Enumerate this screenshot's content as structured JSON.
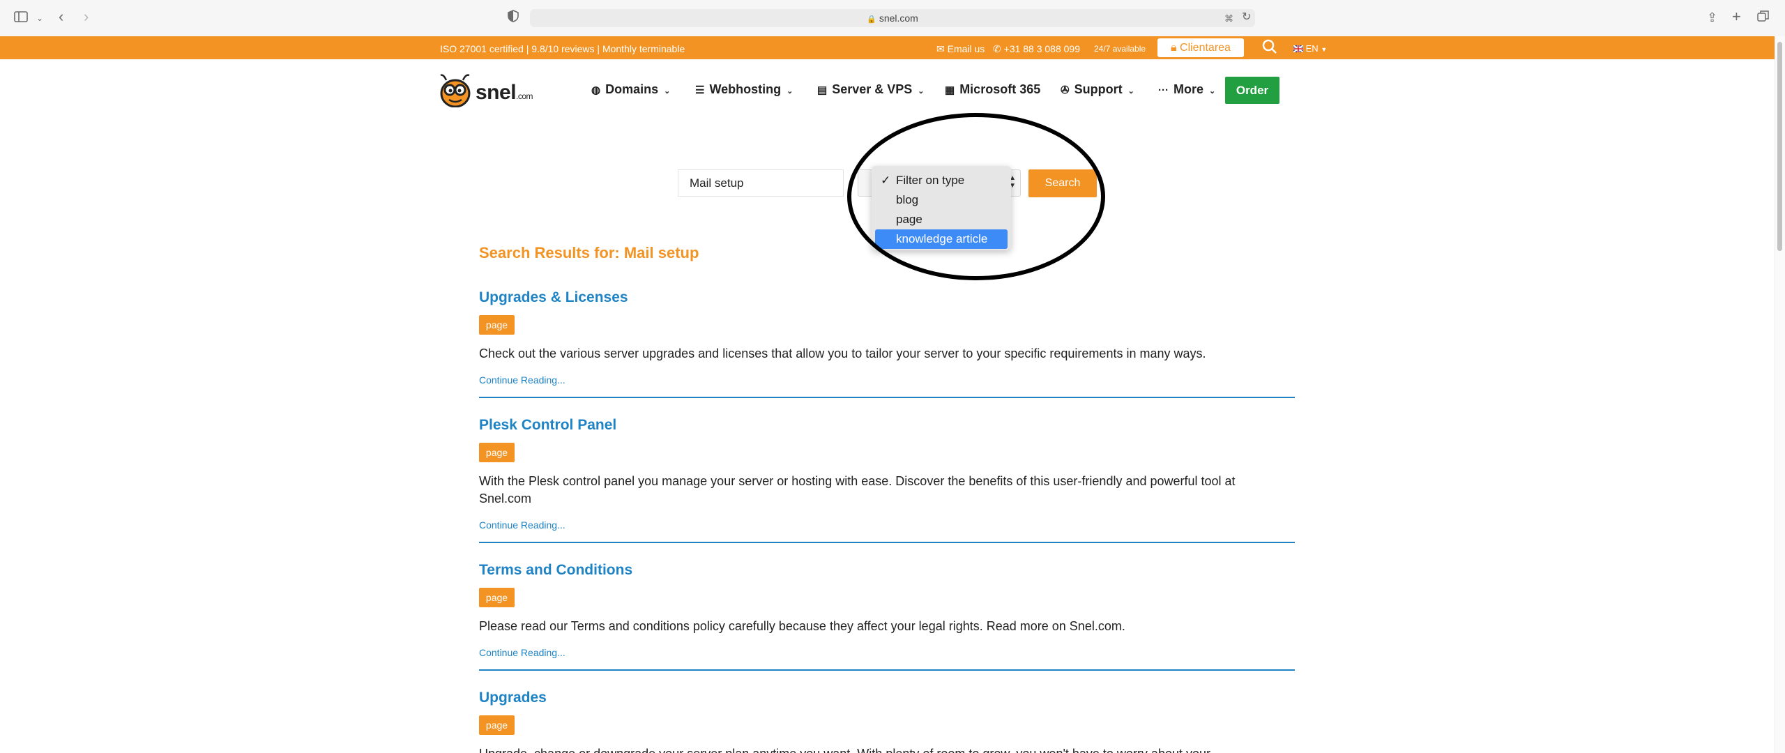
{
  "browser": {
    "url": "snel.com"
  },
  "topbar": {
    "info": "ISO 27001 certified | 9.8/10 reviews | Monthly terminable",
    "email": "Email us",
    "phone": "+31 88 3 088 099",
    "availability": "24/7 available",
    "clientarea": "Clientarea",
    "language": "EN"
  },
  "header": {
    "logo_text": "snel",
    "logo_suffix": ".com",
    "nav": [
      {
        "label": "Domains",
        "icon": "globe-icon"
      },
      {
        "label": "Webhosting",
        "icon": "database-icon"
      },
      {
        "label": "Server & VPS",
        "icon": "server-icon"
      },
      {
        "label": "Microsoft 365",
        "icon": "windows-icon"
      },
      {
        "label": "Support",
        "icon": "lifebuoy-icon"
      },
      {
        "label": "More",
        "icon": "ellipsis-icon"
      }
    ],
    "order": "Order"
  },
  "search": {
    "query": "Mail setup",
    "button": "Search",
    "filter": {
      "options": [
        "Filter on type",
        "blog",
        "page",
        "knowledge article"
      ],
      "checked": "Filter on type",
      "highlighted": "knowledge article"
    }
  },
  "results": {
    "heading": "Search Results for: Mail setup",
    "items": [
      {
        "title": "Upgrades & Licenses",
        "type": "page",
        "description": "Check out the various server upgrades and licenses that allow you to tailor your server to your specific requirements in many ways.",
        "more": "Continue Reading..."
      },
      {
        "title": "Plesk Control Panel",
        "type": "page",
        "description": "With the Plesk control panel you manage your server or hosting with ease. Discover the benefits of this user-friendly and powerful tool at Snel.com",
        "more": "Continue Reading..."
      },
      {
        "title": "Terms and Conditions",
        "type": "page",
        "description": "Please read our Terms and conditions policy carefully because they affect your legal rights. Read more on Snel.com.",
        "more": "Continue Reading..."
      },
      {
        "title": "Upgrades",
        "type": "page",
        "description": "Upgrade, change or downgrade your server plan anytime you want. With plenty of room to grow, you won't have to worry about your"
      }
    ]
  },
  "colors": {
    "brand_orange": "#f39323",
    "link_blue": "#1e83c4",
    "order_green": "#22a041",
    "select_blue": "#3d8bf6"
  }
}
